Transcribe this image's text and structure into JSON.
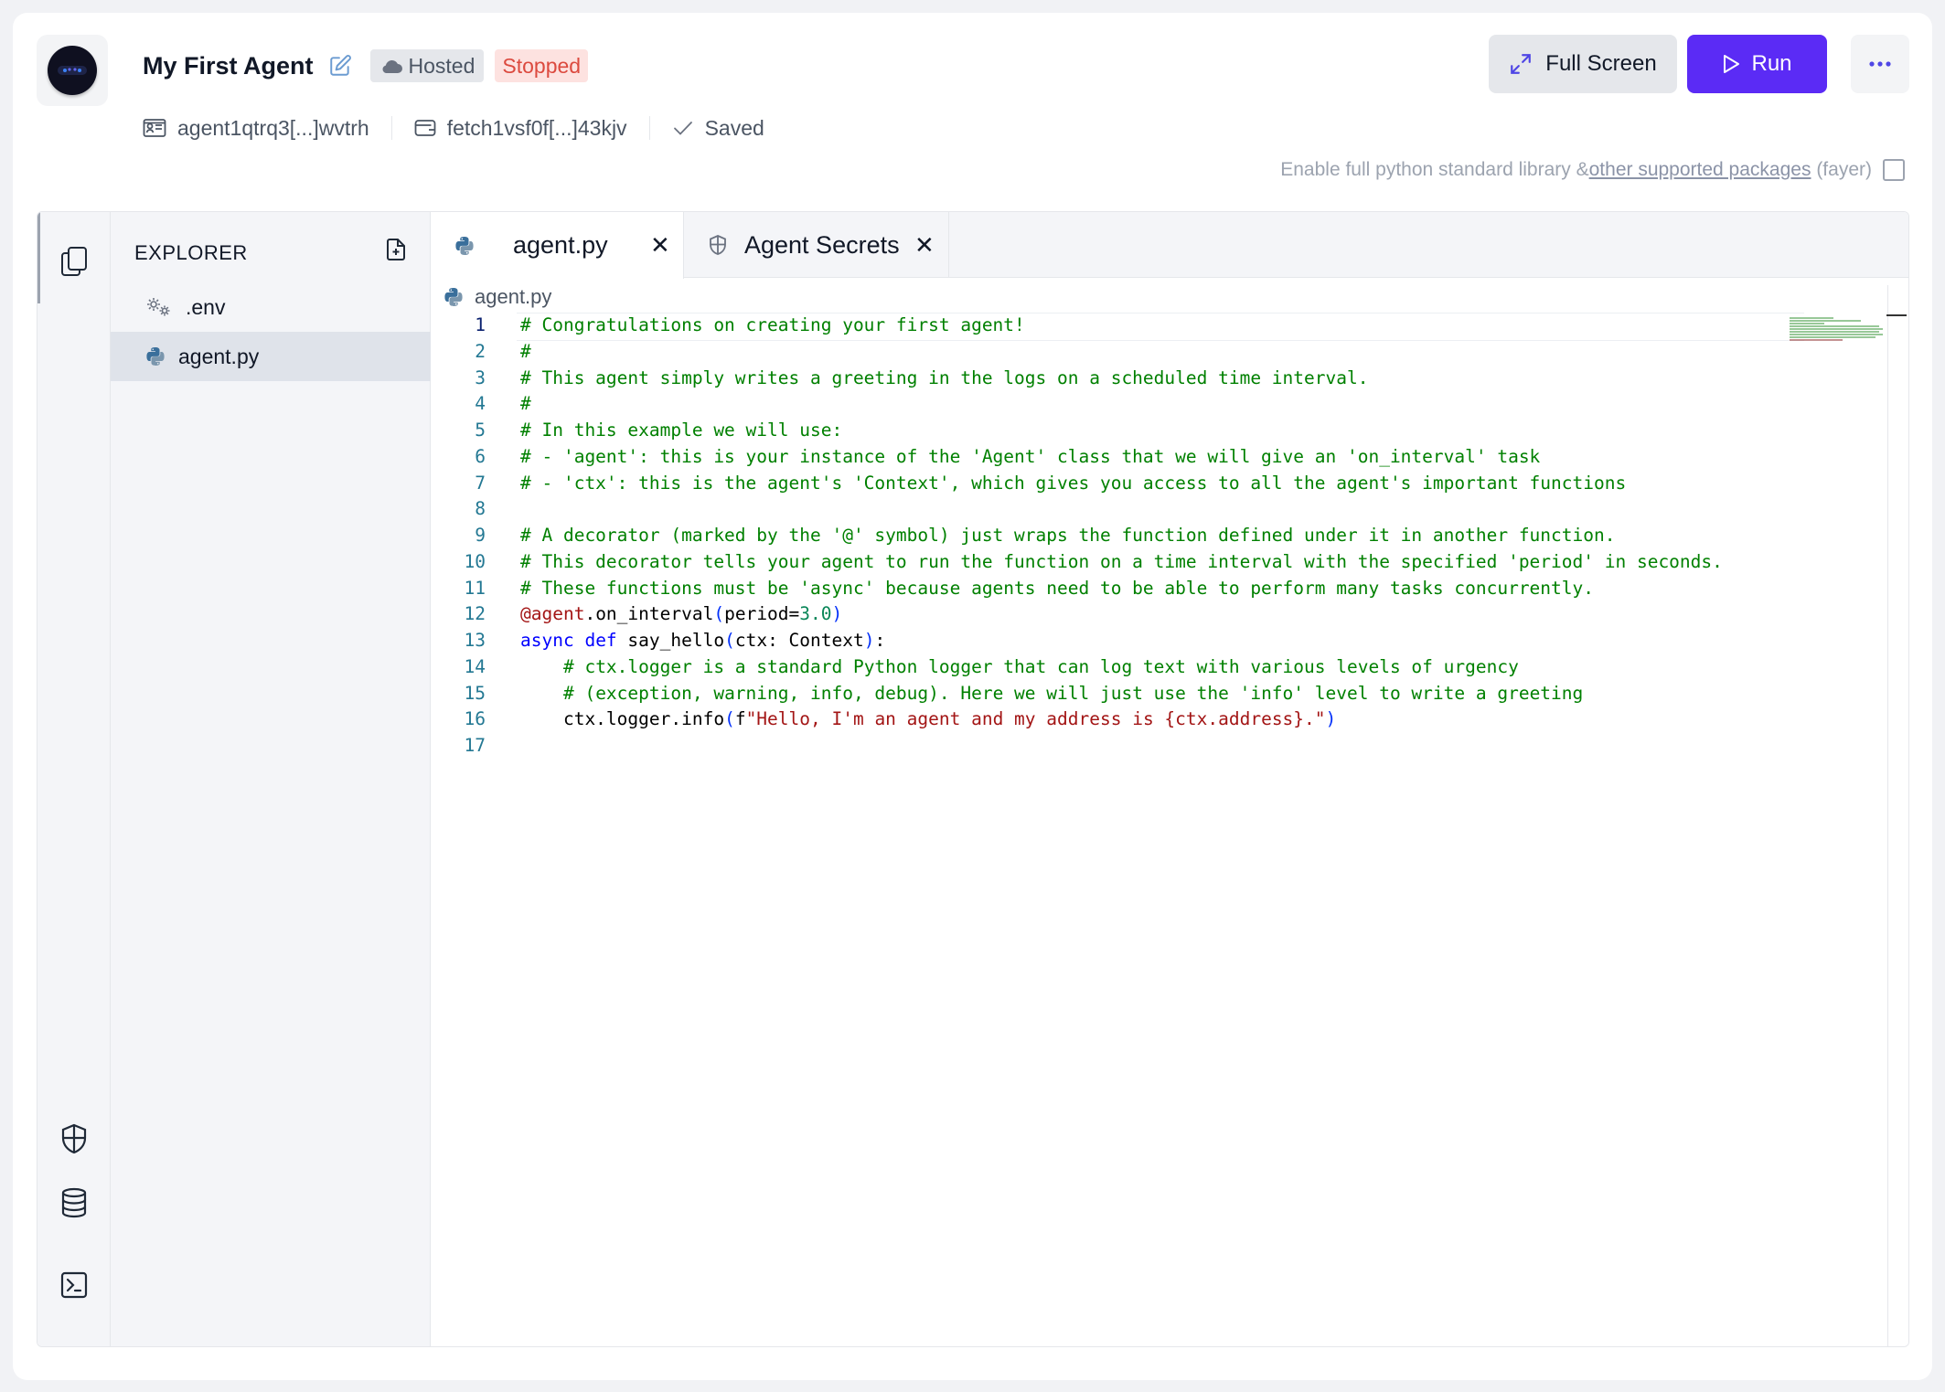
{
  "header": {
    "agent_name": "My First Agent",
    "hosted_label": "Hosted",
    "status_label": "Stopped",
    "address": "agent1qtrq3[...]wvtrh",
    "wallet": "fetch1vsf0f[...]43kjv",
    "saved_label": "Saved",
    "full_screen_label": "Full Screen",
    "run_label": "Run",
    "more_label": "···"
  },
  "stdlib": {
    "text_before": "Enable full python standard library &",
    "link_text": "other supported packages",
    "text_after": "(fayer)"
  },
  "explorer": {
    "title": "EXPLORER",
    "files": [
      {
        "name": ".env",
        "icon": "gear-icon"
      },
      {
        "name": "agent.py",
        "icon": "python-icon"
      }
    ]
  },
  "tabs": [
    {
      "label": "agent.py",
      "icon": "python-icon",
      "active": true
    },
    {
      "label": "Agent Secrets",
      "icon": "shield-icon",
      "active": false
    }
  ],
  "breadcrumb": "agent.py",
  "code_lines": [
    [
      [
        "c",
        "# Congratulations on creating your first agent!"
      ]
    ],
    [
      [
        "c",
        "#"
      ]
    ],
    [
      [
        "c",
        "# This agent simply writes a greeting in the logs on a scheduled time interval."
      ]
    ],
    [
      [
        "c",
        "#"
      ]
    ],
    [
      [
        "c",
        "# In this example we will use:"
      ]
    ],
    [
      [
        "c",
        "# - 'agent': this is your instance of the 'Agent' class that we will give an 'on_interval' task"
      ]
    ],
    [
      [
        "c",
        "# - 'ctx': this is the agent's 'Context', which gives you access to all the agent's important functions"
      ]
    ],
    [
      [
        "p",
        ""
      ]
    ],
    [
      [
        "c",
        "# A decorator (marked by the '@' symbol) just wraps the function defined under it in another function."
      ]
    ],
    [
      [
        "c",
        "# This decorator tells your agent to run the function on a time interval with the specified 'period' in seconds."
      ]
    ],
    [
      [
        "c",
        "# These functions must be 'async' because agents need to be able to perform many tasks concurrently."
      ]
    ],
    [
      [
        "d",
        "@agent"
      ],
      [
        "p",
        ".on_interval"
      ],
      [
        "b",
        "("
      ],
      [
        "p",
        "period="
      ],
      [
        "n",
        "3.0"
      ],
      [
        "b",
        ")"
      ]
    ],
    [
      [
        "k",
        "async"
      ],
      [
        "p",
        " "
      ],
      [
        "k",
        "def"
      ],
      [
        "p",
        " say_hello"
      ],
      [
        "b",
        "("
      ],
      [
        "p",
        "ctx: Context"
      ],
      [
        "b",
        ")"
      ],
      [
        "p",
        ":"
      ]
    ],
    [
      [
        "p",
        "    "
      ],
      [
        "c",
        "# ctx.logger is a standard Python logger that can log text with various levels of urgency"
      ]
    ],
    [
      [
        "p",
        "    "
      ],
      [
        "c",
        "# (exception, warning, info, debug). Here we will just use the 'info' level to write a greeting"
      ]
    ],
    [
      [
        "p",
        "    ctx.logger.info"
      ],
      [
        "b",
        "("
      ],
      [
        "p",
        "f"
      ],
      [
        "s",
        "\"Hello, I'm an agent and my address is {ctx.address}.\""
      ],
      [
        "b",
        ")"
      ]
    ],
    [
      [
        "p",
        ""
      ]
    ]
  ]
}
